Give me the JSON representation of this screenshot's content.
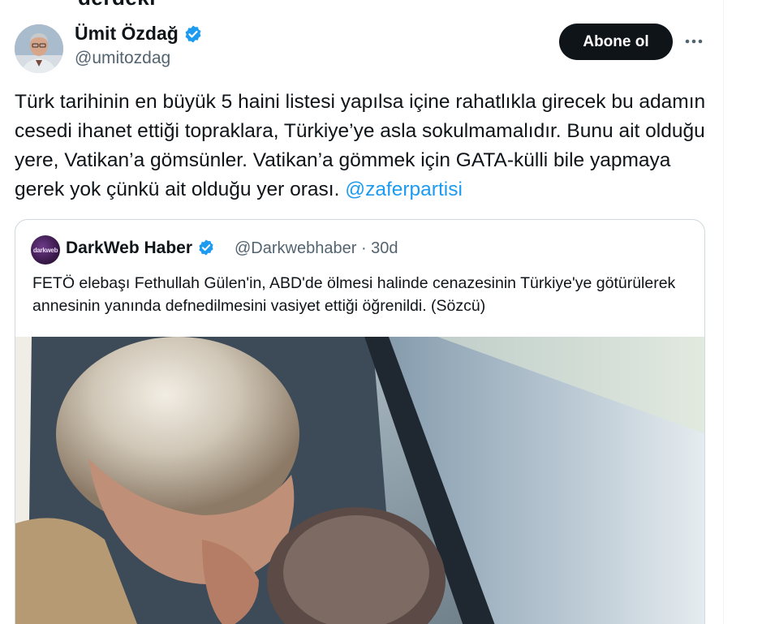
{
  "top_fragment": "derdeki",
  "author": {
    "name": "Ümit Özdağ",
    "handle": "@umitozdag",
    "verified": true
  },
  "actions": {
    "follow_label": "Abone ol",
    "more_icon": "more-horizontal-icon"
  },
  "tweet": {
    "text": "Türk tarihinin en büyük 5 haini listesi yapılsa içine rahatlıkla girecek bu adamın cesedi ihanet ettiği topraklara, Türkiye’ye asla sokulmamalıdır. Bunu ait olduğu yere, Vatikan’a gömsünler. Vatikan’a gömmek için GATA-külli bile yapmaya gerek yok çünkü ait olduğu yer orası.",
    "mention": "@zaferpartisi"
  },
  "quoted": {
    "avatar_text": "darkweb",
    "name": "DarkWeb Haber",
    "verified": true,
    "handle": "@Darkwebhaber",
    "separator": "·",
    "time": "30d",
    "text": "FETÖ elebaşı Fethullah Gülen'in, ABD'de ölmesi halinde cenazesinin Türkiye'ye götürülerek annesinin yanında defnedilmesini vasiyet ettiği öğrenildi. (Sözcü)"
  },
  "colors": {
    "accent": "#1d9bf0",
    "text": "#0f1419",
    "secondary": "#536471",
    "border": "#cfd9de",
    "button_bg": "#0f1419"
  }
}
